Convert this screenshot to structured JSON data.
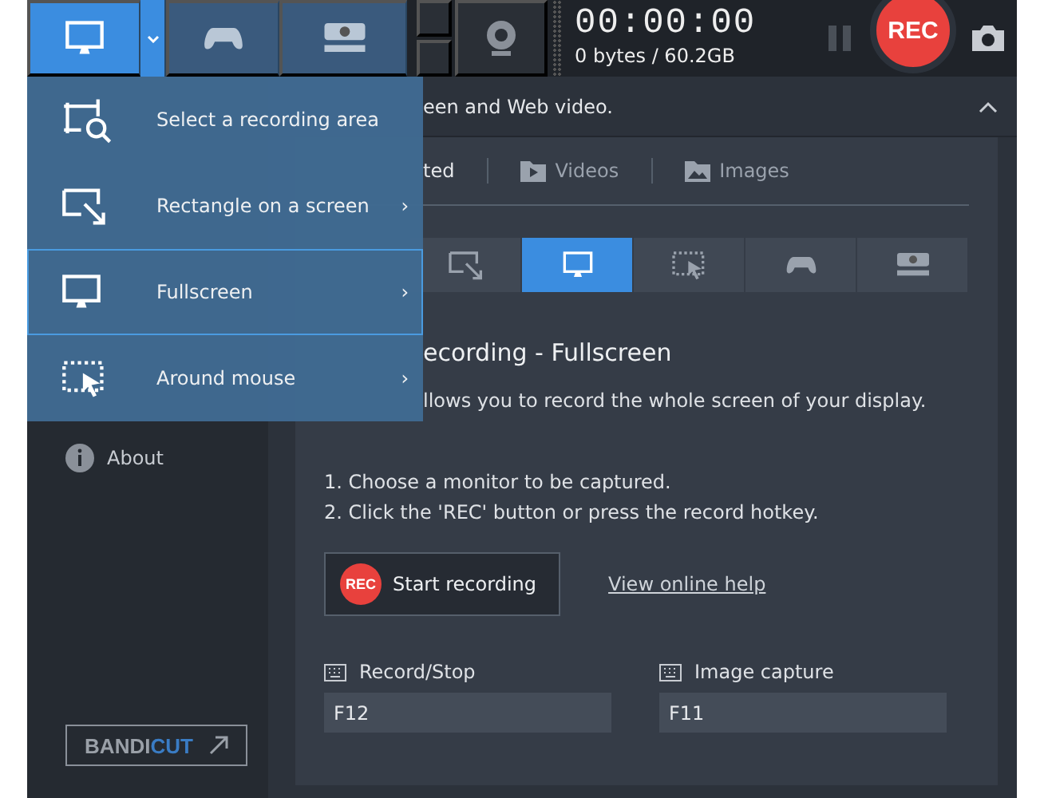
{
  "toolbar": {
    "modes": [
      {
        "kind": "screen",
        "selected": true
      },
      {
        "kind": "gamepad",
        "selected": false
      },
      {
        "kind": "hdmi",
        "selected": false
      }
    ],
    "timer": "00:00:00",
    "storage": "0 bytes / 60.2GB",
    "rec_button": "REC"
  },
  "menu": {
    "items": [
      {
        "kind": "area",
        "label": "Select a recording area",
        "selected": false
      },
      {
        "kind": "rectangle",
        "label": "Rectangle on a screen",
        "arrow": "›",
        "selected": false
      },
      {
        "kind": "screen",
        "label": "Fullscreen",
        "arrow": "›",
        "selected": true
      },
      {
        "kind": "mouse",
        "label": "Around mouse",
        "arrow": "›",
        "selected": false
      }
    ]
  },
  "header": {
    "text": "een and Web video."
  },
  "content_tabs": [
    {
      "kind": "none",
      "label": "ted"
    },
    {
      "kind": "video",
      "label": "Videos"
    },
    {
      "kind": "image",
      "label": "Images"
    }
  ],
  "mode_tiles": [
    {
      "kind": "rectangle",
      "selected": false
    },
    {
      "kind": "screen",
      "selected": true
    },
    {
      "kind": "mouse",
      "selected": false
    },
    {
      "kind": "gamepad",
      "selected": false
    },
    {
      "kind": "hdmi",
      "selected": false
    }
  ],
  "title": "ecording - Fullscreen",
  "description": "llows you to record the whole screen of your display.",
  "steps": [
    "1. Choose a monitor to be captured.",
    "2. Click the 'REC' button or press the record hotkey."
  ],
  "start_button": {
    "badge": "REC",
    "label": "Start recording"
  },
  "help_link": "View online help",
  "hotkeys": [
    {
      "label": "Record/Stop",
      "value": "F12"
    },
    {
      "label": "Image capture",
      "value": "F11"
    }
  ],
  "sidebar": {
    "items": [
      {
        "label": "About"
      }
    ],
    "logo": {
      "brand": "BANDI",
      "accent": "CUT"
    }
  }
}
